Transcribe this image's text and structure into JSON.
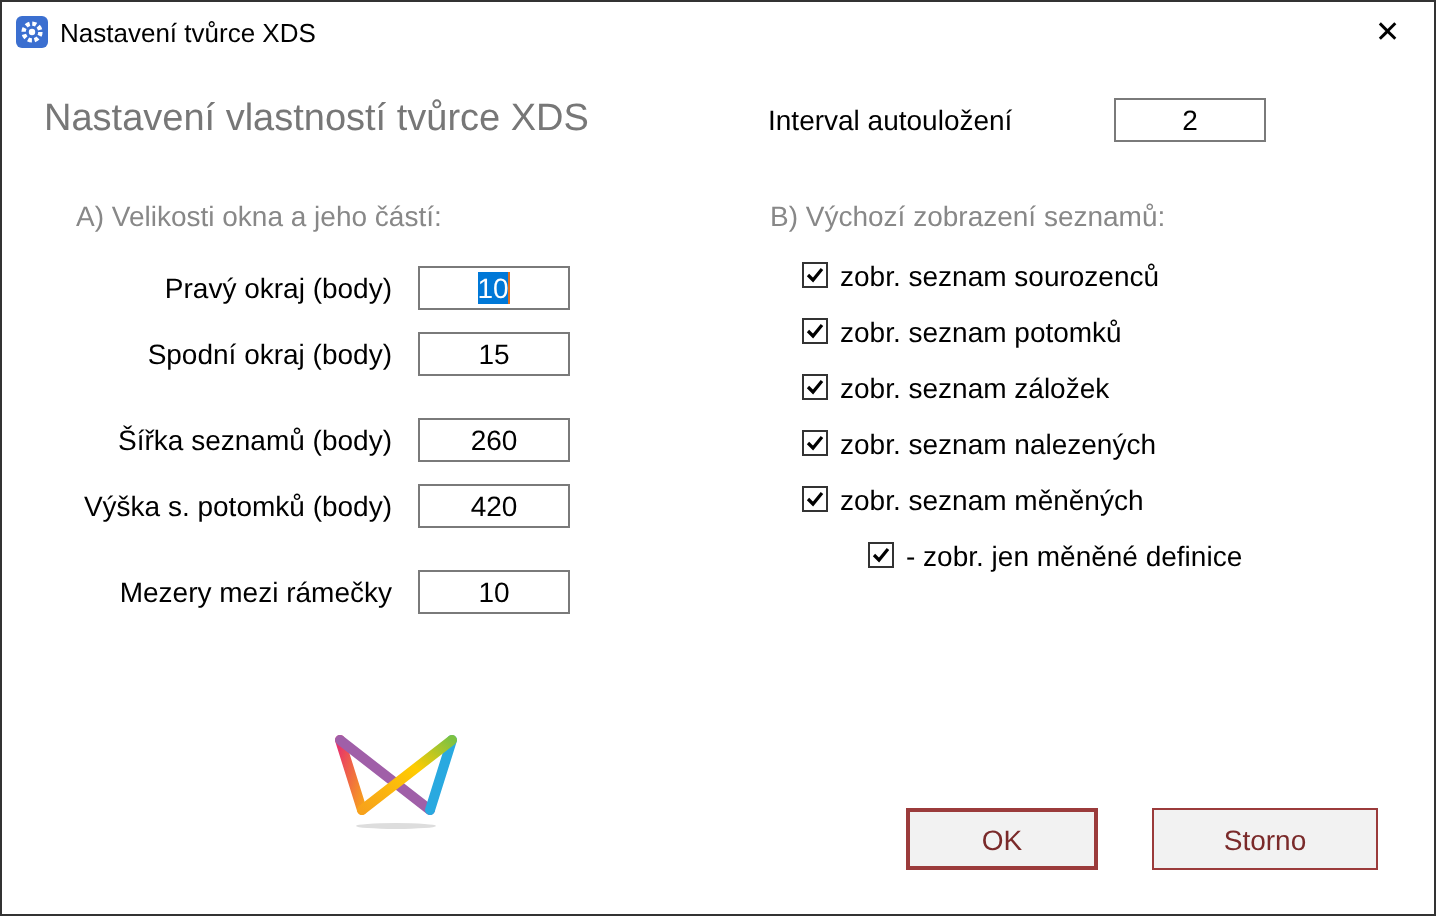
{
  "window": {
    "title": "Nastavení tvůrce XDS",
    "close": "✕"
  },
  "heading": "Nastavení vlastností tvůrce XDS",
  "autosave": {
    "label": "Interval autouložení",
    "value": "2"
  },
  "sizes": {
    "title": "A) Velikosti okna a jeho částí:",
    "groups": [
      [
        {
          "label": "Pravý okraj (body)",
          "value": "10",
          "focused": true
        },
        {
          "label": "Spodní okraj (body)",
          "value": "15",
          "focused": false
        }
      ],
      [
        {
          "label": "Šířka seznamů (body)",
          "value": "260",
          "focused": false
        },
        {
          "label": "Výška s. potomků (body)",
          "value": "420",
          "focused": false
        }
      ],
      [
        {
          "label": "Mezery mezi rámečky",
          "value": "10",
          "focused": false
        }
      ]
    ]
  },
  "lists": {
    "title": "B) Výchozí zobrazení seznamů:",
    "options": [
      {
        "label": "zobr. seznam sourozenců",
        "checked": true
      },
      {
        "label": "zobr. seznam potomků",
        "checked": true
      },
      {
        "label": "zobr. seznam záložek",
        "checked": true
      },
      {
        "label": "zobr. seznam nalezených",
        "checked": true
      },
      {
        "label": "zobr. seznam měněných",
        "checked": true,
        "children": [
          {
            "label": "- zobr. jen měněné definice",
            "checked": true
          }
        ]
      }
    ]
  },
  "buttons": [
    {
      "label": "OK",
      "default": true
    },
    {
      "label": "Storno",
      "default": false
    }
  ]
}
